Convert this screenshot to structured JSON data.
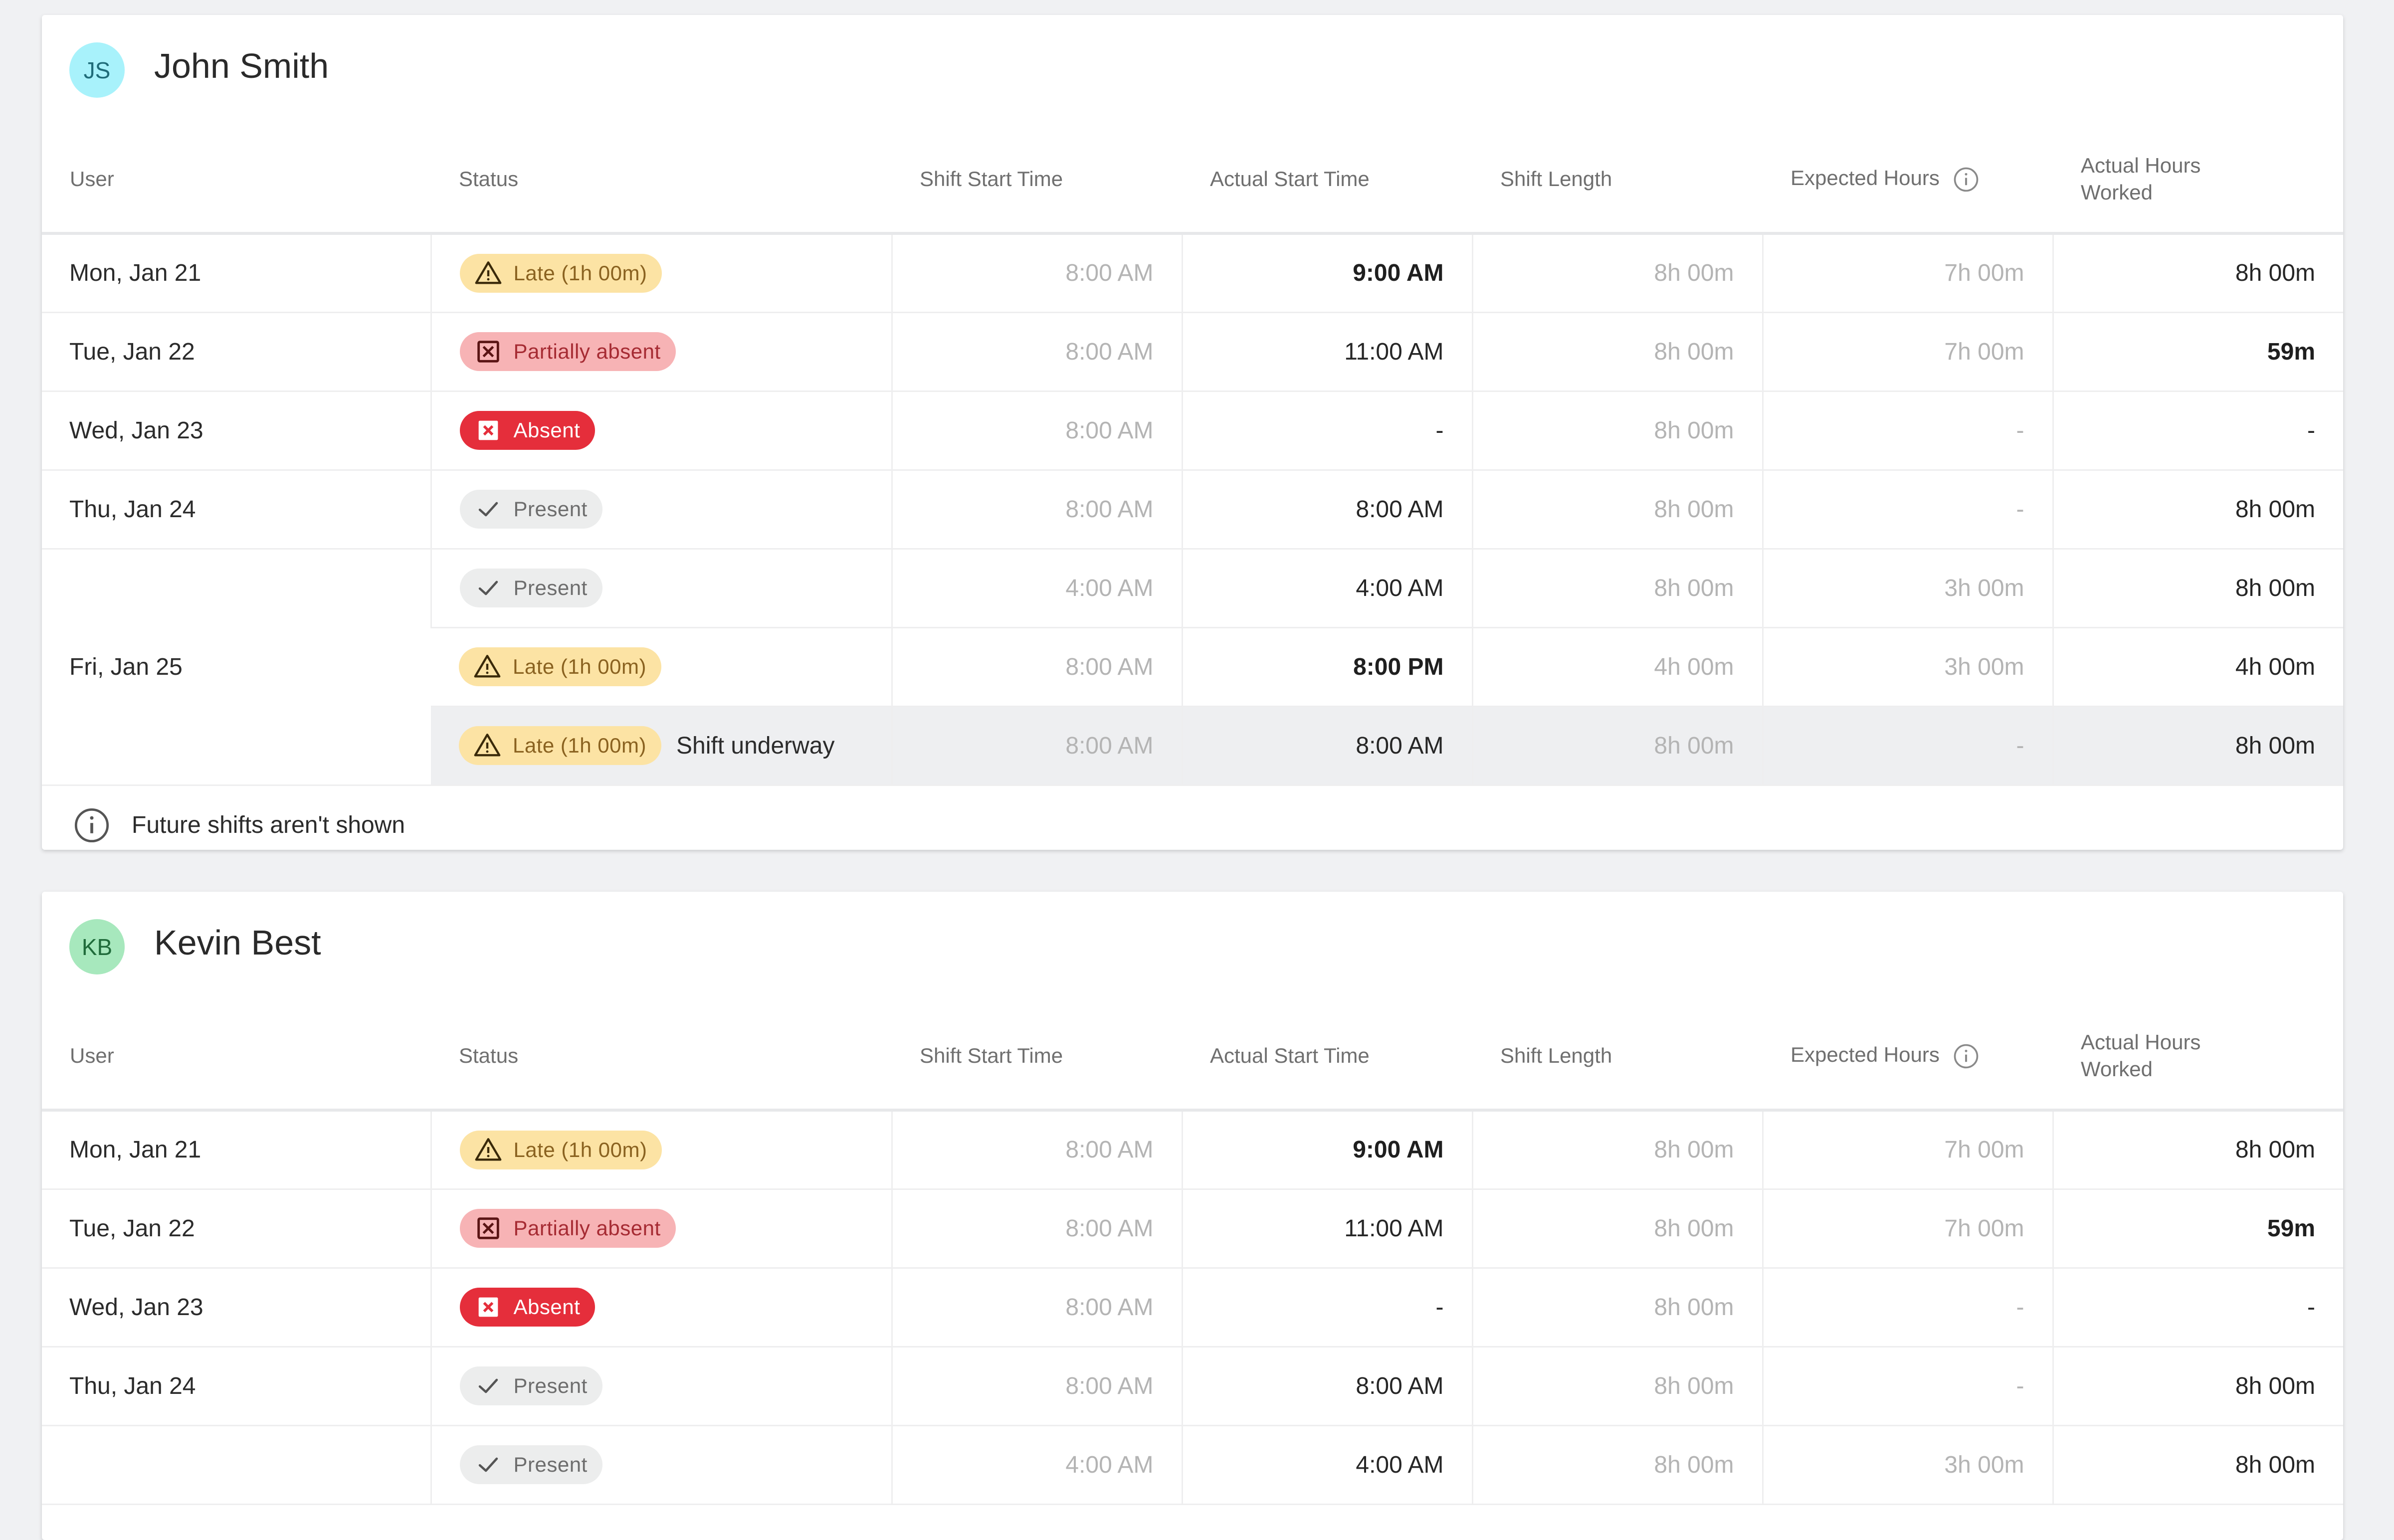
{
  "columns": [
    "User",
    "Status",
    "Shift Start Time",
    "Actual Start Time",
    "Shift Length",
    "Expected Hours",
    "Actual Hours Worked"
  ],
  "actual_hours_header": [
    "Actual Hours",
    "Worked"
  ],
  "colors": {
    "late_bg": "#fce3a4",
    "partial_bg": "#f7b3b5",
    "absent_bg": "#e52e3b",
    "present_bg": "#eceded",
    "avatar_js": "#a8f2fb",
    "avatar_kb": "#a7e8bd"
  },
  "cards": [
    {
      "initials": "JS",
      "name": "John Smith",
      "rows": [
        {
          "date": "Mon, Jan 21",
          "status": "Late (1h 00m)",
          "status_type": "late",
          "shift_start": "8:00 AM",
          "actual_start": "9:00 AM",
          "actual_bold": true,
          "shift_length": "8h 00m",
          "expected": "7h 00m",
          "actual_hours": "8h 00m",
          "actual_hours_bold": false
        },
        {
          "date": "Tue, Jan 22",
          "status": "Partially absent",
          "status_type": "partial",
          "shift_start": "8:00 AM",
          "actual_start": "11:00 AM",
          "actual_bold": false,
          "shift_length": "8h 00m",
          "expected": "7h 00m",
          "actual_hours": "59m",
          "actual_hours_bold": true
        },
        {
          "date": "Wed, Jan 23",
          "status": "Absent",
          "status_type": "absent",
          "shift_start": "8:00 AM",
          "actual_start": "-",
          "actual_bold": false,
          "shift_length": "8h 00m",
          "expected": "-",
          "actual_hours": "-",
          "actual_hours_bold": false
        },
        {
          "date": "Thu, Jan 24",
          "status": "Present",
          "status_type": "present",
          "shift_start": "8:00 AM",
          "actual_start": "8:00 AM",
          "actual_bold": false,
          "shift_length": "8h 00m",
          "expected": "-",
          "actual_hours": "8h 00m",
          "actual_hours_bold": false
        },
        {
          "date": "",
          "status": "Present",
          "status_type": "present",
          "shift_start": "4:00 AM",
          "actual_start": "4:00 AM",
          "actual_bold": false,
          "shift_length": "8h 00m",
          "expected": "3h 00m",
          "actual_hours": "8h 00m",
          "actual_hours_bold": false
        },
        {
          "date": "Fri, Jan 25",
          "status": "Late (1h 00m)",
          "status_type": "late",
          "shift_start": "8:00 AM",
          "actual_start": "8:00 PM",
          "actual_bold": true,
          "shift_length": "4h 00m",
          "expected": "3h 00m",
          "actual_hours": "4h 00m",
          "actual_hours_bold": false
        },
        {
          "date": "",
          "status": "Late (1h 00m)",
          "status_type": "late",
          "note": "Shift underway",
          "highlight": true,
          "shift_start": "8:00 AM",
          "actual_start": "8:00 AM",
          "actual_bold": false,
          "shift_length": "8h 00m",
          "expected": "-",
          "actual_hours": "8h 00m",
          "actual_hours_bold": false
        }
      ],
      "footer_note": "Future shifts aren't shown"
    },
    {
      "initials": "KB",
      "name": "Kevin Best",
      "rows": [
        {
          "date": "Mon, Jan 21",
          "status": "Late (1h 00m)",
          "status_type": "late",
          "shift_start": "8:00 AM",
          "actual_start": "9:00 AM",
          "actual_bold": true,
          "shift_length": "8h 00m",
          "expected": "7h 00m",
          "actual_hours": "8h 00m",
          "actual_hours_bold": false
        },
        {
          "date": "Tue, Jan 22",
          "status": "Partially absent",
          "status_type": "partial",
          "shift_start": "8:00 AM",
          "actual_start": "11:00 AM",
          "actual_bold": false,
          "shift_length": "8h 00m",
          "expected": "7h 00m",
          "actual_hours": "59m",
          "actual_hours_bold": true
        },
        {
          "date": "Wed, Jan 23",
          "status": "Absent",
          "status_type": "absent",
          "shift_start": "8:00 AM",
          "actual_start": "-",
          "actual_bold": false,
          "shift_length": "8h 00m",
          "expected": "-",
          "actual_hours": "-",
          "actual_hours_bold": false
        },
        {
          "date": "Thu, Jan 24",
          "status": "Present",
          "status_type": "present",
          "shift_start": "8:00 AM",
          "actual_start": "8:00 AM",
          "actual_bold": false,
          "shift_length": "8h 00m",
          "expected": "-",
          "actual_hours": "8h 00m",
          "actual_hours_bold": false
        },
        {
          "date": "",
          "status": "Present",
          "status_type": "present",
          "shift_start": "4:00 AM",
          "actual_start": "4:00 AM",
          "actual_bold": false,
          "shift_length": "8h 00m",
          "expected": "3h 00m",
          "actual_hours": "8h 00m",
          "actual_hours_bold": false
        }
      ]
    }
  ]
}
